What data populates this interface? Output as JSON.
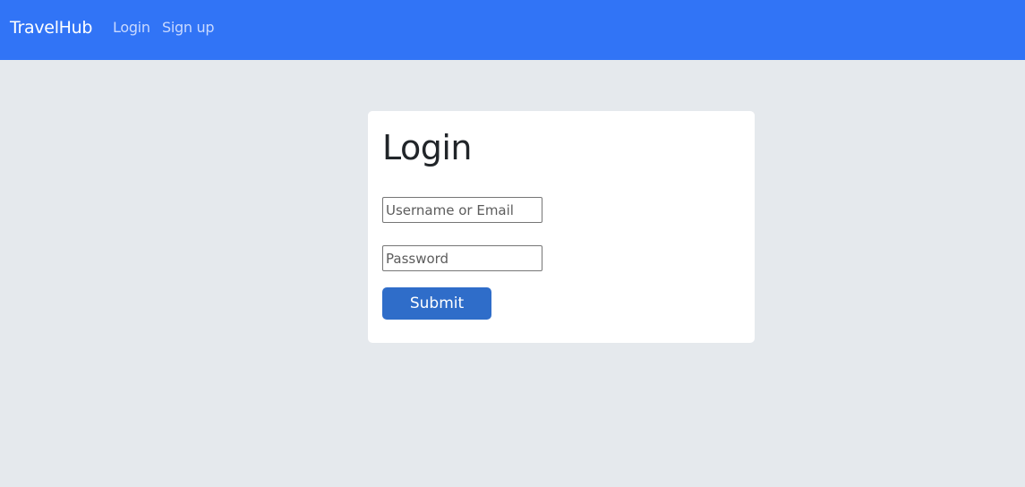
{
  "navbar": {
    "brand": "TravelHub",
    "links": [
      {
        "label": "Login"
      },
      {
        "label": "Sign up"
      }
    ]
  },
  "login_form": {
    "title": "Login",
    "username_placeholder": "Username or Email",
    "username_value": "",
    "password_placeholder": "Password",
    "password_value": "",
    "submit_label": "Submit"
  },
  "colors": {
    "navbar_bg": "#3174f6",
    "page_bg": "#e5e9ed",
    "button_bg": "#2f6dc9"
  }
}
